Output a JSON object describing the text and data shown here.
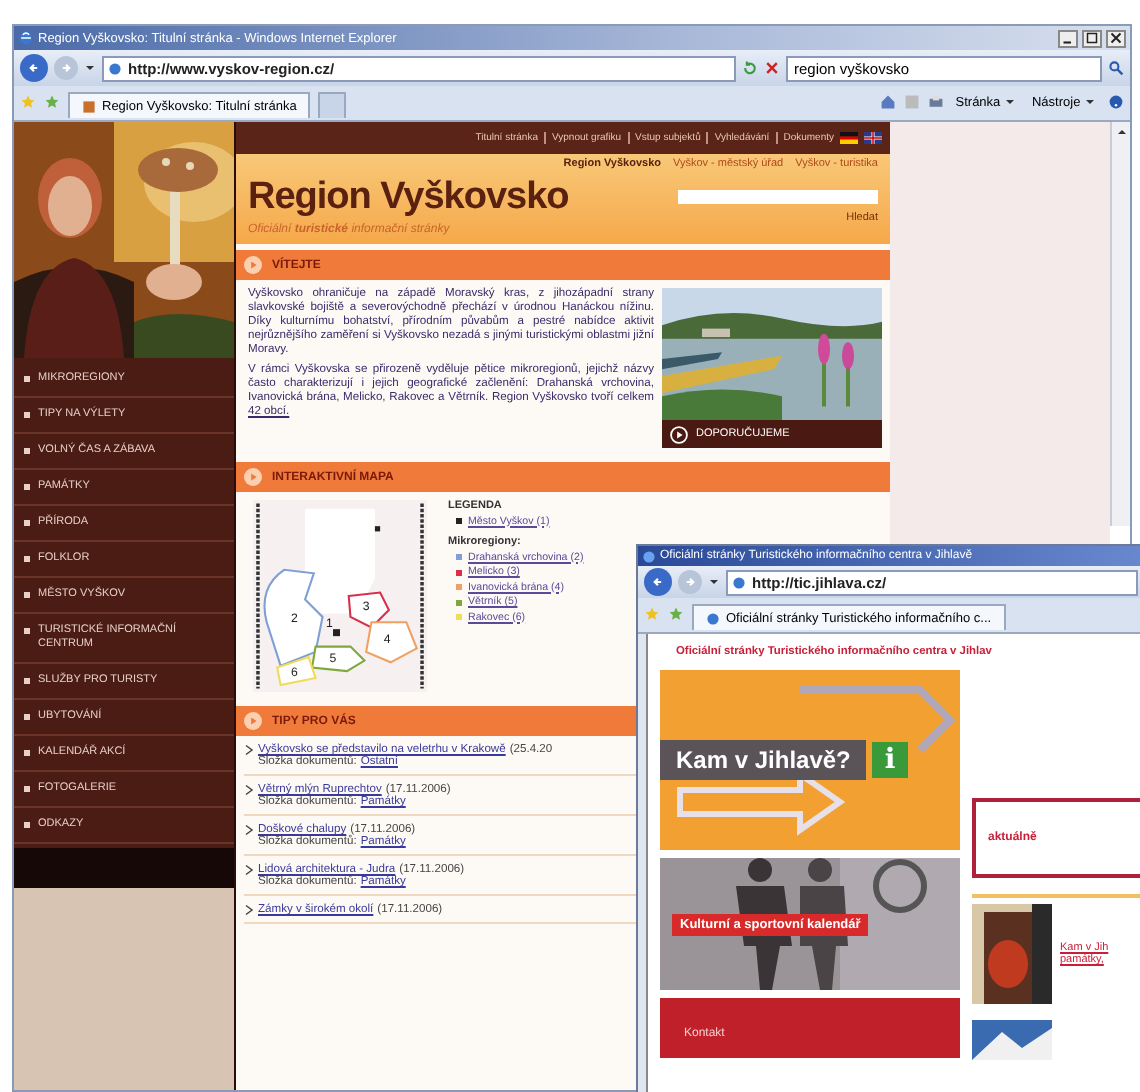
{
  "window": {
    "title": "Region Vyškovsko: Titulní stránka - Windows Internet Explorer"
  },
  "address": {
    "url": "http://www.vyskov-region.cz/"
  },
  "search": {
    "value": "region vyškovsko"
  },
  "tabs": [
    {
      "label": "Region Vyškovsko: Titulní stránka",
      "selected": true
    }
  ],
  "toolbar": {
    "menus": [
      "Stránka",
      "Nástroje"
    ]
  },
  "site": {
    "top_links": [
      "Titulní stránka",
      "Vypnout grafiku",
      "Vstup subjektů",
      "Vyhledávání",
      "Dokumenty"
    ],
    "crumbs": [
      {
        "label": "Region Vyškovsko",
        "selected": true
      },
      {
        "label": "Vyškov - městský úřad",
        "selected": false
      },
      {
        "label": "Vyškov - turistika",
        "selected": false
      }
    ],
    "title": "Region Vyškovsko",
    "subtitle": "Oficiální **turistické** informační stránky",
    "search_button": "Hledat",
    "menu": [
      "MIKROREGIONY",
      "TIPY NA VÝLETY",
      "VOLNÝ ČAS A ZÁBAVA",
      "PAMÁTKY",
      "PŘÍRODA",
      "FOLKLOR",
      "MĚSTO VYŠKOV",
      "TURISTICKÉ INFORMAČNÍ CENTRUM",
      "SLUŽBY PRO TURISTY",
      "UBYTOVÁNÍ",
      "KALENDÁŘ AKCÍ",
      "FOTOGALERIE",
      "ODKAZY"
    ],
    "welcome": {
      "heading": "VÍTEJTE",
      "paragraphs": [
        {
          "text": "Vyškovsko ohraničuje na západě Moravský kras, z jihozápadní strany slavkovské bojiště a severovýchodně přechází v úrodnou Hanáckou nížinu. Díky kulturnímu bohatství, přírodním půvabům a pestré nabídce aktivit nejrůznějšího zaměření si Vyškovsko nezadá s jinými turistickými oblastmi jižní Moravy."
        },
        {
          "text": "V rámci Vyškovska se přirozeně vyděluje pětice mikroregionů, jejichž názvy často charakterizují i jejich geografické začlenění: Drahanská vrchovina, Ivanovická brána, Melicko, Rakovec a Větrník. Region Vyškovsko tvoří celkem",
          "link": "42 obcí."
        }
      ],
      "feature": "DOPORUČUJEME"
    },
    "map": {
      "heading": "INTERAKTIVNÍ MAPA",
      "legend_title": "LEGENDA",
      "city": {
        "label": "Město Vyškov (1)",
        "marker": "1",
        "color": "#222222"
      },
      "regions_title": "Mikroregiony:",
      "regions": [
        {
          "label": "Drahanská vrchovina (2)",
          "marker": "2",
          "color": "#7f9fd6"
        },
        {
          "label": "Melicko (3)",
          "marker": "3",
          "color": "#d8304c"
        },
        {
          "label": "Ivanovická brána (4)",
          "marker": "4",
          "color": "#f0a060"
        },
        {
          "label": "Větrník (5)",
          "marker": "5",
          "color": "#7fa83c"
        },
        {
          "label": "Rakovec (6)",
          "marker": "6",
          "color": "#eedc5a"
        }
      ]
    },
    "tips": {
      "heading": "TIPY PRO VÁS",
      "items": [
        {
          "title": "Vyškovsko se představilo na veletrhu v Krakowě",
          "date": "(25.4.20",
          "folder_label": "Složka dokumentů:",
          "folder": "Ostatní"
        },
        {
          "title": "Větrný mlýn Ruprechtov",
          "date": "(17.11.2006)",
          "folder_label": "Složka dokumentů:",
          "folder": "Památky"
        },
        {
          "title": "Doškové chalupy",
          "date": "(17.11.2006)",
          "folder_label": "Složka dokumentů:",
          "folder": "Památky"
        },
        {
          "title": "Lidová architektura - Judra",
          "date": "(17.11.2006)",
          "folder_label": "Složka dokumentů:",
          "folder": "Památky"
        },
        {
          "title": "Zámky v širokém okolí",
          "date": "(17.11.2006)"
        }
      ]
    }
  },
  "second_window": {
    "title": "Oficiální stránky Turistického informačního centra v Jihlavě",
    "url": "http://tic.jihlava.cz/",
    "tab": "Oficiální stránky Turistického informačního c...",
    "heading": "Oficiální stránky Turistického informačního centra v Jihlav",
    "banner": "Kam v Jihlavě?",
    "info_badge": "i",
    "news_heading": "aktuálně",
    "calendar": "Kulturní a sportovní kalendář",
    "contact": "Kontakt",
    "teaser_link": "Kam v Jih",
    "teaser_text": "památky,"
  }
}
